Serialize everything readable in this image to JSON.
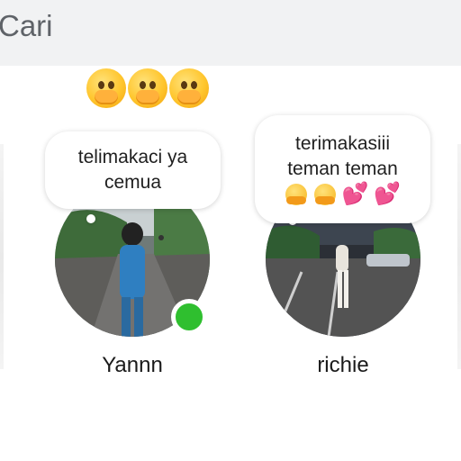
{
  "search": {
    "placeholder": "Cari"
  },
  "reactions": {
    "icons": [
      "hand-over-mouth-emoji",
      "hand-over-mouth-emoji",
      "hand-over-mouth-emoji"
    ]
  },
  "stories": [
    {
      "name": "Yannn",
      "note": "telimakaci ya cemua",
      "note_lines": [
        "telimakaci ya",
        "cemua"
      ],
      "online": true,
      "status_color": "#2fbf2f"
    },
    {
      "name": "richie",
      "note_lines": [
        "terimakasiii",
        "teman teman"
      ],
      "note_emojis": [
        "hugging-face",
        "hugging-face",
        "two-hearts",
        "two-hearts"
      ],
      "online": false
    }
  ]
}
